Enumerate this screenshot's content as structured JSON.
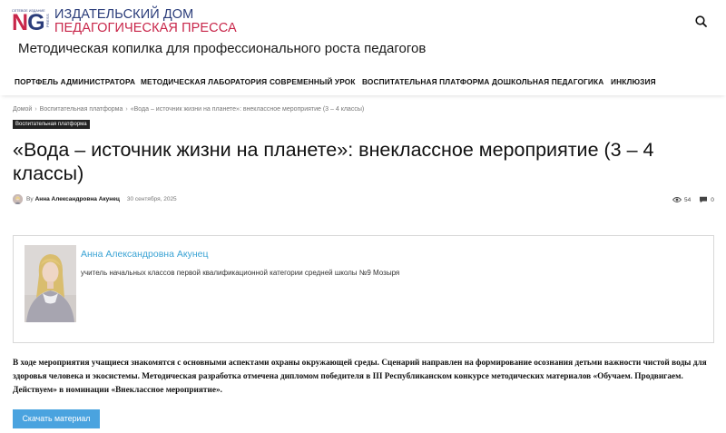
{
  "header": {
    "logo_small": "СЕТЕВОЕ ИЗДАНИЕ",
    "logo_ng": "NG",
    "logo_press": "PRESS",
    "logo_line1": "ИЗДАТЕЛЬСКИЙ ДОМ",
    "logo_line2": "ПЕДАГОГИЧЕСКАЯ ПРЕССА",
    "tagline": "Методическая копилка для профессионального роста педагогов",
    "search_icon": "search-icon"
  },
  "nav": {
    "items": [
      {
        "label": "ПОРТФЕЛЬ АДМИНИСТРАТОРА"
      },
      {
        "label": "МЕТОДИЧЕСКАЯ ЛАБОРАТОРИЯ"
      },
      {
        "label": "СОВРЕМЕННЫЙ УРОК"
      },
      {
        "label": "ВОСПИТАТЕЛЬНАЯ ПЛАТФОРМА"
      },
      {
        "label": "ДОШКОЛЬНАЯ ПЕДАГОГИКА"
      },
      {
        "label": "ИНКЛЮЗИЯ"
      }
    ]
  },
  "breadcrumb": {
    "home": "Домой",
    "section": "Воспитательная платформа",
    "current": "«Вода – источник жизни на планете»: внеклассное мероприятие (3 – 4 классы)",
    "separator": "›"
  },
  "article": {
    "category": "Воспитательная платформа",
    "title": "«Вода – источник жизни на планете»: внеклассное мероприятие (3 – 4 классы)",
    "by": "By",
    "author": "Анна Александровна Акунец",
    "date": "30 сентября, 2025",
    "views": "54",
    "comments": "0"
  },
  "author_box": {
    "name": "Анна Александровна Акунец",
    "description": "учитель начальных классов первой квалификационной категории средней школы №9 Мозыря"
  },
  "description": "В ходе мероприятия учащиеся знакомятся с основными аспектами охраны окружающей среды. Сценарий направлен на формирование осознания детьми важности чистой воды для здоровья человека и экосистемы. Методическая разработка отмечена дипломом победителя в III Республиканском конкурсе методических материалов «Обучаем. Продвигаем. Действуем» в номинации «Внеклассное мероприятие».",
  "download_button": "Скачать материал",
  "colors": {
    "brand_blue": "#2b3d7a",
    "brand_red": "#c8264a",
    "accent_blue": "#4aa3df",
    "author_link": "#3aa3d4"
  }
}
